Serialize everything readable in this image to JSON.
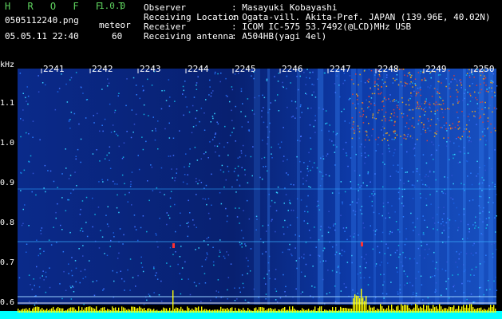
{
  "app": {
    "title": "H R O F F T",
    "version": "1.0.0"
  },
  "file": {
    "name": "0505112240.png",
    "datetime": "05.05.11 22:40"
  },
  "mode": {
    "label": "meteor",
    "count": "60"
  },
  "info": {
    "rows": [
      {
        "key": "Observer",
        "value": ": Masayuki Kobayashi"
      },
      {
        "key": "Receiving Location",
        "value": ": Ogata-vill. Akita-Pref. JAPAN (139.96E, 40.02N)"
      },
      {
        "key": "Receiver",
        "value": ": ICOM IC-575 53.7492(@LCD)MHz USB"
      },
      {
        "key": "Receiving antenna",
        "value": ": A504HB(yagi 4el)"
      }
    ]
  },
  "axis": {
    "unit": "kHz",
    "y_ticks": [
      "1.1",
      "1.0",
      "0.9",
      "0.8",
      "0.7",
      "0.6"
    ],
    "time_ticks": [
      "2241",
      "2242",
      "2243",
      "2244",
      "2245",
      "2246",
      "2247",
      "2248",
      "2249",
      "2250"
    ]
  },
  "colors": {
    "background": "#000000",
    "header_green": "#5fd35f",
    "bar_yellow": "#ffff00",
    "bar_cyan": "#00ffff"
  }
}
